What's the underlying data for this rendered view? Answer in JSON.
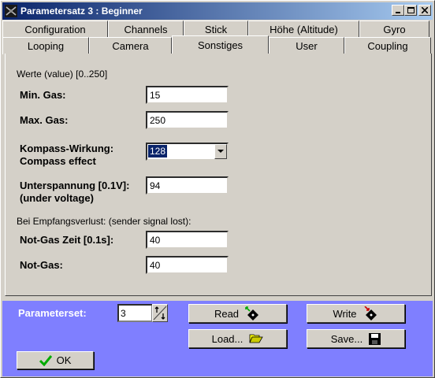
{
  "window": {
    "title": "Parametersatz 3 : Beginner"
  },
  "tabs_row1": [
    "Configuration",
    "Channels",
    "Stick",
    "Höhe (Altitude)",
    "Gyro"
  ],
  "tabs_row2": [
    "Looping",
    "Camera",
    "Sonstiges",
    "User",
    "Coupling"
  ],
  "active_tab": "Sonstiges",
  "fields": {
    "range_note": "Werte (value) [0..250]",
    "min_gas_label": "Min. Gas:",
    "min_gas_value": "15",
    "max_gas_label": "Max. Gas:",
    "max_gas_value": "250",
    "compass_label_1": "Kompass-Wirkung:",
    "compass_label_2": "Compass effect",
    "compass_value": "128",
    "undervoltage_label_1": "Unterspannung [0.1V]:",
    "undervoltage_label_2": "(under voltage)",
    "undervoltage_value": "94",
    "signal_lost_note": "Bei Empfangsverlust: (sender signal lost):",
    "notgas_time_label": "Not-Gas Zeit [0.1s]:",
    "notgas_time_value": "40",
    "notgas_label": "Not-Gas:",
    "notgas_value": "40"
  },
  "bottom": {
    "parameterset_label": "Parameterset:",
    "parameterset_value": "3",
    "read_label": "Read",
    "write_label": "Write",
    "load_label": "Load...",
    "save_label": "Save...",
    "ok_label": "OK"
  },
  "colors": {
    "titlebar": "#0a246a",
    "bottom_panel": "#7f7fff",
    "face": "#d4d0c8"
  }
}
